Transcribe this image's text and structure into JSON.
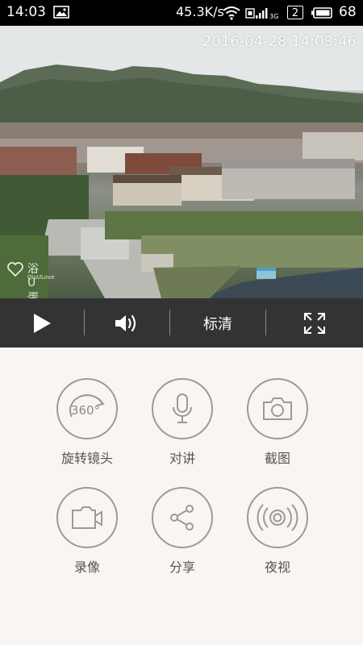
{
  "status_bar": {
    "time": "14:03",
    "net_speed": "45.3K/s",
    "sim_slot": "2",
    "battery_level": "68",
    "icons": [
      "gallery-icon",
      "wifi-icon",
      "signal-3g-icon",
      "sim-icon",
      "battery-icon"
    ]
  },
  "video": {
    "timestamp": "2016-04-28 14:03:46",
    "watermark": "浴U蛋",
    "watermark_sub": "QiuULove"
  },
  "controls": {
    "play_icon": "play-icon",
    "volume_icon": "volume-icon",
    "quality_label": "标清",
    "fullscreen_icon": "fullscreen-icon"
  },
  "actions": [
    {
      "icon": "rotate-360-icon",
      "label": "旋转镜头"
    },
    {
      "icon": "microphone-icon",
      "label": "对讲"
    },
    {
      "icon": "camera-icon",
      "label": "截图"
    },
    {
      "icon": "video-camera-icon",
      "label": "录像"
    },
    {
      "icon": "share-icon",
      "label": "分享"
    },
    {
      "icon": "night-vision-icon",
      "label": "夜视"
    }
  ],
  "colors": {
    "status_bar_bg": "#000000",
    "control_bar_bg": "#333333",
    "panel_bg": "#f9f6f2",
    "icon_stroke": "#9a9a9a",
    "label_text": "#555555"
  }
}
